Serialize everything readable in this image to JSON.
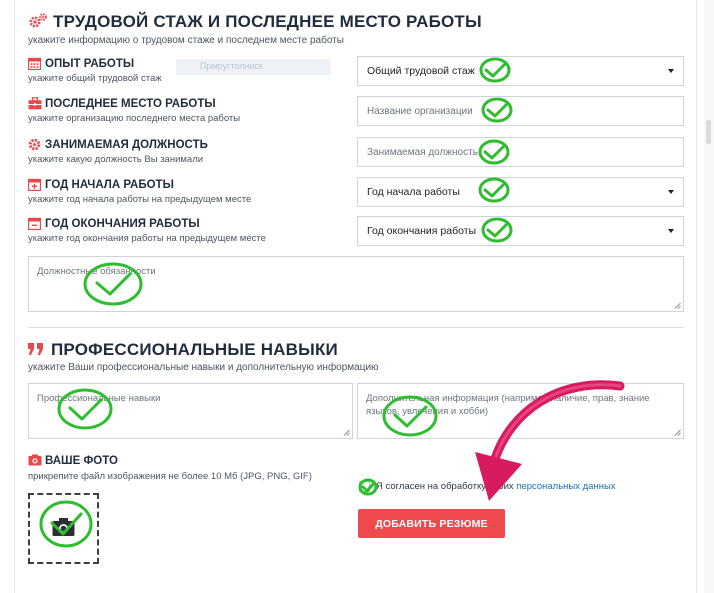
{
  "work_section": {
    "title": "ТРУДОВОЙ СТАЖ И ПОСЛЕДНЕЕ МЕСТО РАБОТЫ",
    "hint": "укажите информацию о трудовом стаже и последнем месте работы",
    "faded_chip": "Прмругтолниск",
    "fields": [
      {
        "label": "ОПЫТ РАБОТЫ",
        "hint": "укажите общий трудовой стаж",
        "value": "Общий трудовой стаж",
        "icon": "calendar-icon"
      },
      {
        "label": "ПОСЛЕДНЕЕ МЕСТО РАБОТЫ",
        "hint": "укажите организацию последнего места работы",
        "placeholder": "Название организации",
        "icon": "briefcase-icon"
      },
      {
        "label": "ЗАНИМАЕМАЯ ДОЛЖНОСТЬ",
        "hint": "укажите какую должность Вы занимали",
        "placeholder": "Занимаемая должность",
        "icon": "gear-icon"
      },
      {
        "label": "ГОД НАЧАЛА РАБОТЫ",
        "hint": "укажите год начала работы на предыдущем месте",
        "value": "Год начала работы",
        "icon": "calendar-plus-icon"
      },
      {
        "label": "ГОД ОКОНЧАНИЯ РАБОТЫ",
        "hint": "укажите год окончания работы на предыдущем месте",
        "value": "Год окончания работы",
        "icon": "calendar-minus-icon"
      }
    ],
    "duties_placeholder": "Должностные обязанности"
  },
  "skills_section": {
    "title": "ПРОФЕССИОНАЛЬНЫЕ НАВЫКИ",
    "hint": "укажите Ваши профессиональные навыки и дополнительную информацию",
    "skills_placeholder": "Профессиональные навыки",
    "extra_placeholder": "Дополнительная информация (например наличие, прав, знание языков, увлечения и хобби)"
  },
  "photo_section": {
    "label": "ВАШЕ ФОТО",
    "hint": "прикрепите файл изображения не более 10 Мб (JPG, PNG, GIF)"
  },
  "consent": {
    "text": "Я согласен на обработку своих ",
    "link": "персональных данных"
  },
  "submit_label": "ДОБАВИТЬ РЕЗЮМЕ",
  "colors": {
    "accent_red": "#e8484c",
    "check_green": "#2ebd2e",
    "arrow_pink": "#d81b60",
    "link_blue": "#1a72b8"
  }
}
